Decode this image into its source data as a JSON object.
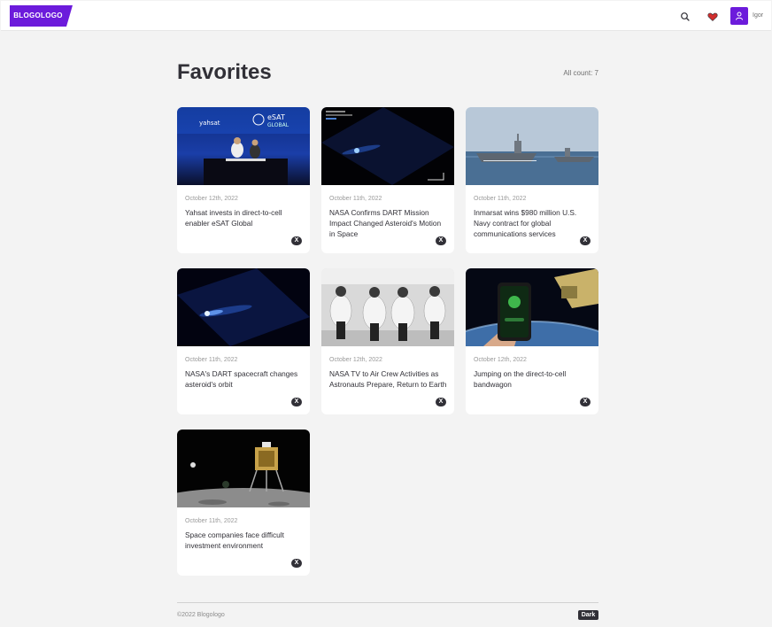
{
  "header": {
    "logo_text": "BLOGOLOGO",
    "username": "Igor",
    "accent_color": "#6c1bdb",
    "icons": [
      "search-icon",
      "heart-icon",
      "user-icon"
    ]
  },
  "main": {
    "title": "Favorites",
    "count_label": "All count: 7",
    "cards": [
      {
        "date": "October 12th, 2022",
        "title": "Yahsat invests in direct-to-cell enabler eSAT Global",
        "remove_label": "X",
        "image": "press-conference-photo"
      },
      {
        "date": "October 11th, 2022",
        "title": "NASA Confirms DART Mission Impact Changed Asteroid's Motion in Space",
        "remove_label": "X",
        "image": "asteroid-telescope-photo"
      },
      {
        "date": "October 11th, 2022",
        "title": "Inmarsat wins $980 million U.S. Navy contract for global communications services",
        "remove_label": "X",
        "image": "aircraft-carrier-photo"
      },
      {
        "date": "October 11th, 2022",
        "title": "NASA's DART spacecraft changes asteroid's orbit",
        "remove_label": "X",
        "image": "asteroid-trail-photo"
      },
      {
        "date": "October 12th, 2022",
        "title": "NASA TV to Air Crew Activities as Astronauts Prepare, Return to Earth",
        "remove_label": "X",
        "image": "astronauts-capsule-photo"
      },
      {
        "date": "October 12th, 2022",
        "title": "Jumping on the direct-to-cell bandwagon",
        "remove_label": "X",
        "image": "phone-satellite-photo"
      },
      {
        "date": "October 11th, 2022",
        "title": "Space companies face difficult investment environment",
        "remove_label": "X",
        "image": "lunar-lander-photo"
      }
    ]
  },
  "footer": {
    "copyright": "©2022 Blogologo",
    "theme_label": "Dark"
  }
}
